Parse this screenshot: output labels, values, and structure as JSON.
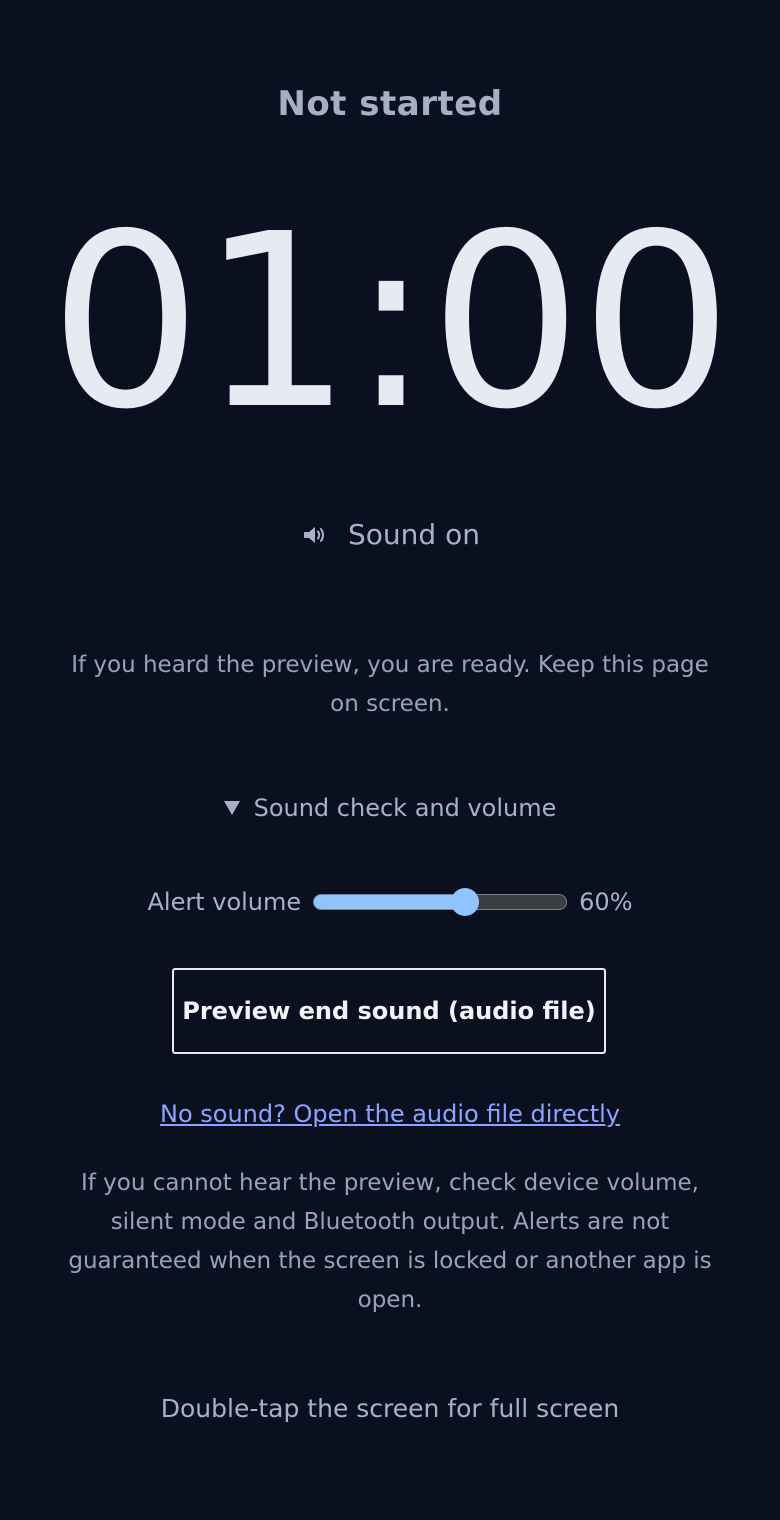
{
  "status": "Not started",
  "timer": "01:00",
  "sound": {
    "label": "Sound on",
    "icon": "speaker-icon"
  },
  "ready_note": "If you heard the preview, you are ready. Keep this page on screen.",
  "sound_check": {
    "summary": "Sound check and volume",
    "expanded": true,
    "volume_label": "Alert volume",
    "volume_value": 60,
    "volume_text": "60%",
    "preview_button": "Preview end sound (audio file)",
    "audio_link": "No sound? Open the audio file directly",
    "help_note": "If you cannot hear the preview, check device volume, silent mode and Bluetooth output. Alerts are not guaranteed when the screen is locked or another app is open."
  },
  "fullscreen_hint": "Double-tap the screen for full screen",
  "colors": {
    "background": "#0b1020",
    "accent": "#8fc4ff",
    "link": "#8ea2ff",
    "text": "#a9b1c4",
    "timer": "#e6eaf3"
  }
}
